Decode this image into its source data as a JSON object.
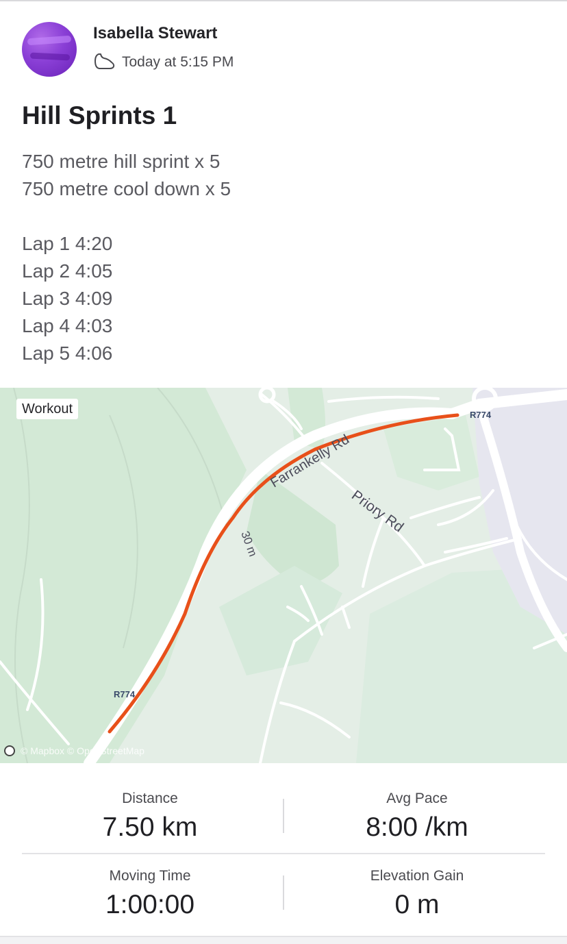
{
  "activity": {
    "athlete_name": "Isabella Stewart",
    "timestamp": "Today at 5:15 PM",
    "activity_icon": "shoe-icon",
    "title": "Hill Sprints 1",
    "description_lines": [
      "750 metre hill sprint x 5",
      "750 metre cool down x 5"
    ],
    "laps": [
      "Lap 1 4:20",
      "Lap 2 4:05",
      "Lap 3 4:09",
      "Lap 4 4:03",
      "Lap 5 4:06"
    ]
  },
  "map": {
    "tag": "Workout",
    "road_labels": {
      "road_main": "Farrankelly Rd",
      "road_side": "Priory Rd",
      "route_code_top": "R774",
      "route_code_bottom": "R774",
      "contour": "30 m"
    },
    "attribution": "© Mapbox © OpenStreetMap",
    "route_color": "#e8501a"
  },
  "stats": {
    "distance": {
      "label": "Distance",
      "value": "7.50 km"
    },
    "avg_pace": {
      "label": "Avg Pace",
      "value": "8:00 /km"
    },
    "moving_time": {
      "label": "Moving Time",
      "value": "1:00:00"
    },
    "elevation_gain": {
      "label": "Elevation Gain",
      "value": "0 m"
    }
  }
}
